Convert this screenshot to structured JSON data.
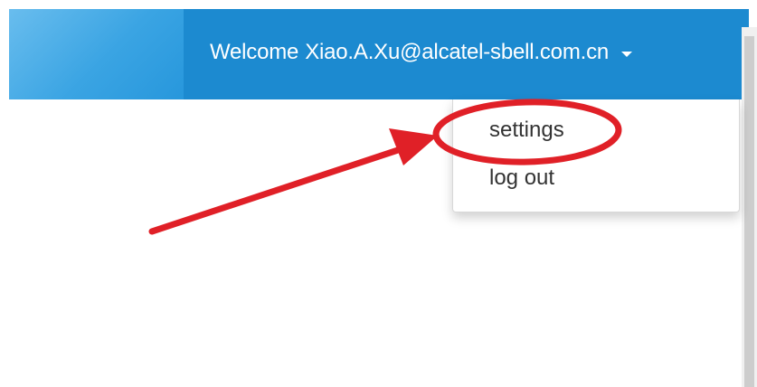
{
  "header": {
    "welcome_prefix": "Welcome",
    "user_email": "Xiao.A.Xu@alcatel-sbell.com.cn",
    "caret_icon": "caret-down-icon"
  },
  "dropdown": {
    "items": [
      {
        "label": "settings"
      },
      {
        "label": "log out"
      }
    ]
  },
  "annotation": {
    "color": "#e02027",
    "highlighted_item": "settings"
  },
  "colors": {
    "header_blue": "#1c8ad0",
    "header_light_blue": "#3aa4e3",
    "text_dark": "#333333"
  }
}
